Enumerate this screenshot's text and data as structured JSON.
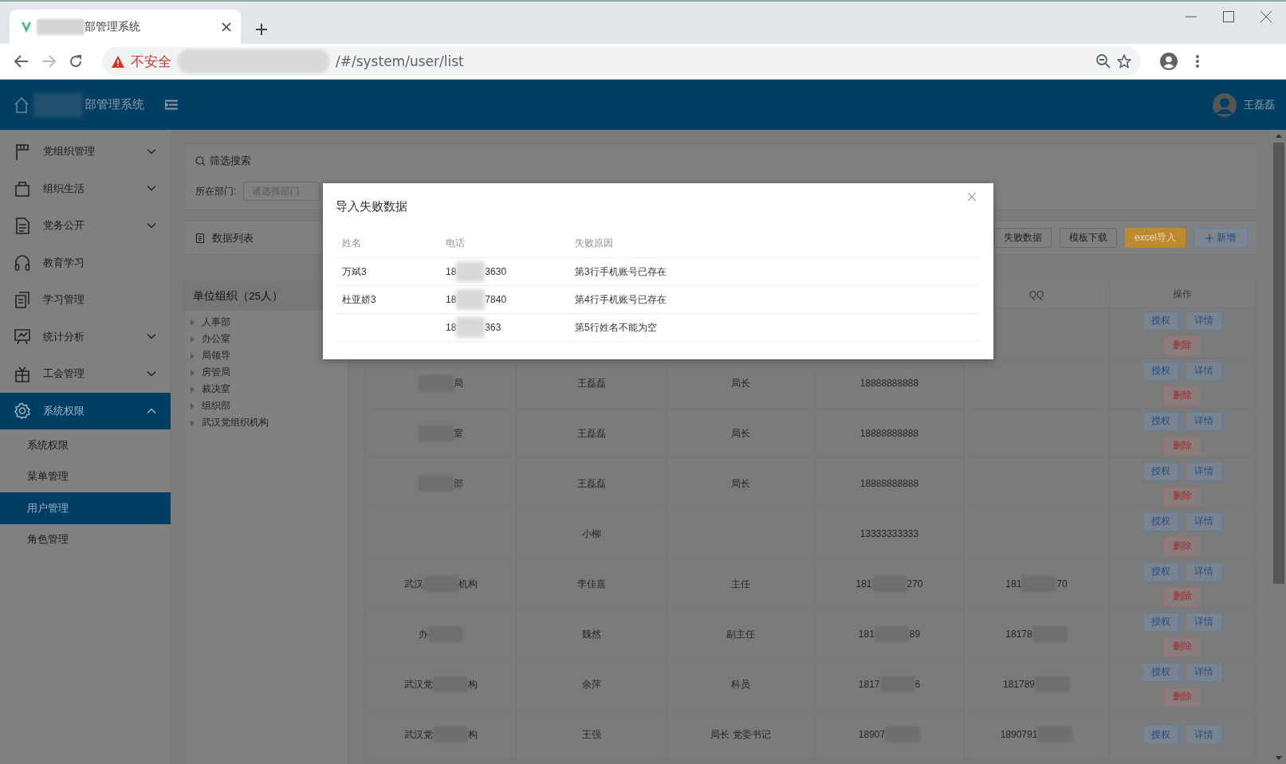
{
  "browser": {
    "tab_title": "部管理系统",
    "security_label": "不安全",
    "url": "/#/system/user/list"
  },
  "header": {
    "title": "部管理系统",
    "user": "王磊磊"
  },
  "sidebar": {
    "items": [
      {
        "label": "党组织管理",
        "expandable": true,
        "expanded": false,
        "selected": false
      },
      {
        "label": "组织生活",
        "expandable": true,
        "expanded": false,
        "selected": false
      },
      {
        "label": "党务公开",
        "expandable": true,
        "expanded": false,
        "selected": false
      },
      {
        "label": "教育学习",
        "expandable": false,
        "selected": false
      },
      {
        "label": "学习管理",
        "expandable": false,
        "selected": false
      },
      {
        "label": "统计分析",
        "expandable": true,
        "expanded": false,
        "selected": false
      },
      {
        "label": "工会管理",
        "expandable": true,
        "expanded": false,
        "selected": false
      },
      {
        "label": "系统权限",
        "expandable": true,
        "expanded": true,
        "selected": true,
        "children": [
          {
            "label": "系统权限",
            "selected": false
          },
          {
            "label": "菜单管理",
            "selected": false
          },
          {
            "label": "用户管理",
            "selected": true
          },
          {
            "label": "角色管理",
            "selected": false
          }
        ]
      }
    ]
  },
  "search": {
    "title": "筛选搜索",
    "dept_label": "所在部门:",
    "dept_placeholder": "请选择部门"
  },
  "list": {
    "title": "数据列表",
    "buttons": [
      {
        "label": "失败数据",
        "kind": "default"
      },
      {
        "label": "模板下载",
        "kind": "default"
      },
      {
        "label": "excel导入",
        "kind": "warning"
      },
      {
        "label": "新增",
        "kind": "primary"
      }
    ]
  },
  "tree": {
    "title": "单位组织（25人）",
    "items": [
      {
        "label": "人事部",
        "expanded": false
      },
      {
        "label": "办公室",
        "expanded": false
      },
      {
        "label": "局领导",
        "expanded": false
      },
      {
        "label": "房管局",
        "expanded": false
      },
      {
        "label": "裁决室",
        "expanded": false
      },
      {
        "label": "组织部",
        "expanded": false
      },
      {
        "label": "武汉党组织机构",
        "expanded": false
      }
    ]
  },
  "table": {
    "header": {
      "column_5": "QQ",
      "column_6": "操作"
    },
    "rows": [
      {
        "actions": [
          "授权",
          "详情",
          "删除"
        ]
      },
      {
        "column_1": {
          "parts": [
            "局"
          ],
          "redacted_head": true
        },
        "column_2": "王磊磊",
        "column_3": "局长",
        "column_4": "18888888888",
        "actions": [
          "授权",
          "详情",
          "删除"
        ]
      },
      {
        "column_1": {
          "parts": [
            "室"
          ],
          "redacted_head": true
        },
        "column_2": "王磊磊",
        "column_3": "局长",
        "column_4": "18888888888",
        "actions": [
          "授权",
          "详情",
          "删除"
        ]
      },
      {
        "column_1": {
          "parts": [
            "部"
          ],
          "redacted_head": true
        },
        "column_2": "王磊磊",
        "column_3": "局长",
        "column_4": "18888888888",
        "actions": [
          "授权",
          "详情",
          "删除"
        ]
      },
      {
        "column_2": "小柳",
        "column_4": "13333333333",
        "actions": [
          "授权",
          "详情",
          "删除"
        ]
      },
      {
        "column_1": {
          "parts": [
            "武汉",
            "机构"
          ]
        },
        "column_2": "李佳嘉",
        "column_3": "主任",
        "column_4": {
          "parts": [
            "181",
            "270"
          ]
        },
        "column_5": {
          "parts": [
            "181",
            "70"
          ]
        },
        "actions": [
          "授权",
          "详情",
          "删除"
        ]
      },
      {
        "column_1": {
          "parts": [
            "办"
          ],
          "redacted_tail": true
        },
        "column_2": "魏然",
        "column_3": "副主任",
        "column_4": {
          "parts": [
            "181",
            "89"
          ]
        },
        "column_5": {
          "parts": [
            "18178"
          ],
          "redacted_tail": true
        },
        "actions": [
          "授权",
          "详情",
          "删除"
        ]
      },
      {
        "column_1": {
          "parts": [
            "武汉党",
            "构"
          ]
        },
        "column_2": "余萍",
        "column_3": "科员",
        "column_4": {
          "parts": [
            "1817",
            "6"
          ]
        },
        "column_5": {
          "parts": [
            "181789"
          ],
          "redacted_tail": true
        },
        "actions": [
          "授权",
          "详情",
          "删除"
        ]
      },
      {
        "column_1": {
          "parts": [
            "武汉党",
            "构"
          ]
        },
        "column_2": "王强",
        "column_3": "局长 党委书记",
        "column_4": {
          "parts": [
            "18907"
          ],
          "redacted_tail": true
        },
        "column_5": {
          "parts": [
            "1890791"
          ],
          "redacted_tail": true
        },
        "actions": [
          "授权",
          "详情"
        ]
      }
    ]
  },
  "dialog": {
    "title": "导入失败数据",
    "columns": [
      "姓名",
      "电话",
      "失败原因"
    ],
    "rows": [
      {
        "name": "万斌3",
        "phone": {
          "parts": [
            "18",
            "3630"
          ]
        },
        "reason": "第3行手机账号已存在"
      },
      {
        "name": "杜亚娇3",
        "phone": {
          "parts": [
            "18",
            "7840"
          ]
        },
        "reason": "第4行手机账号已存在"
      },
      {
        "phone": {
          "parts": [
            "18",
            "363"
          ]
        },
        "reason": "第5行姓名不能为空"
      }
    ]
  }
}
